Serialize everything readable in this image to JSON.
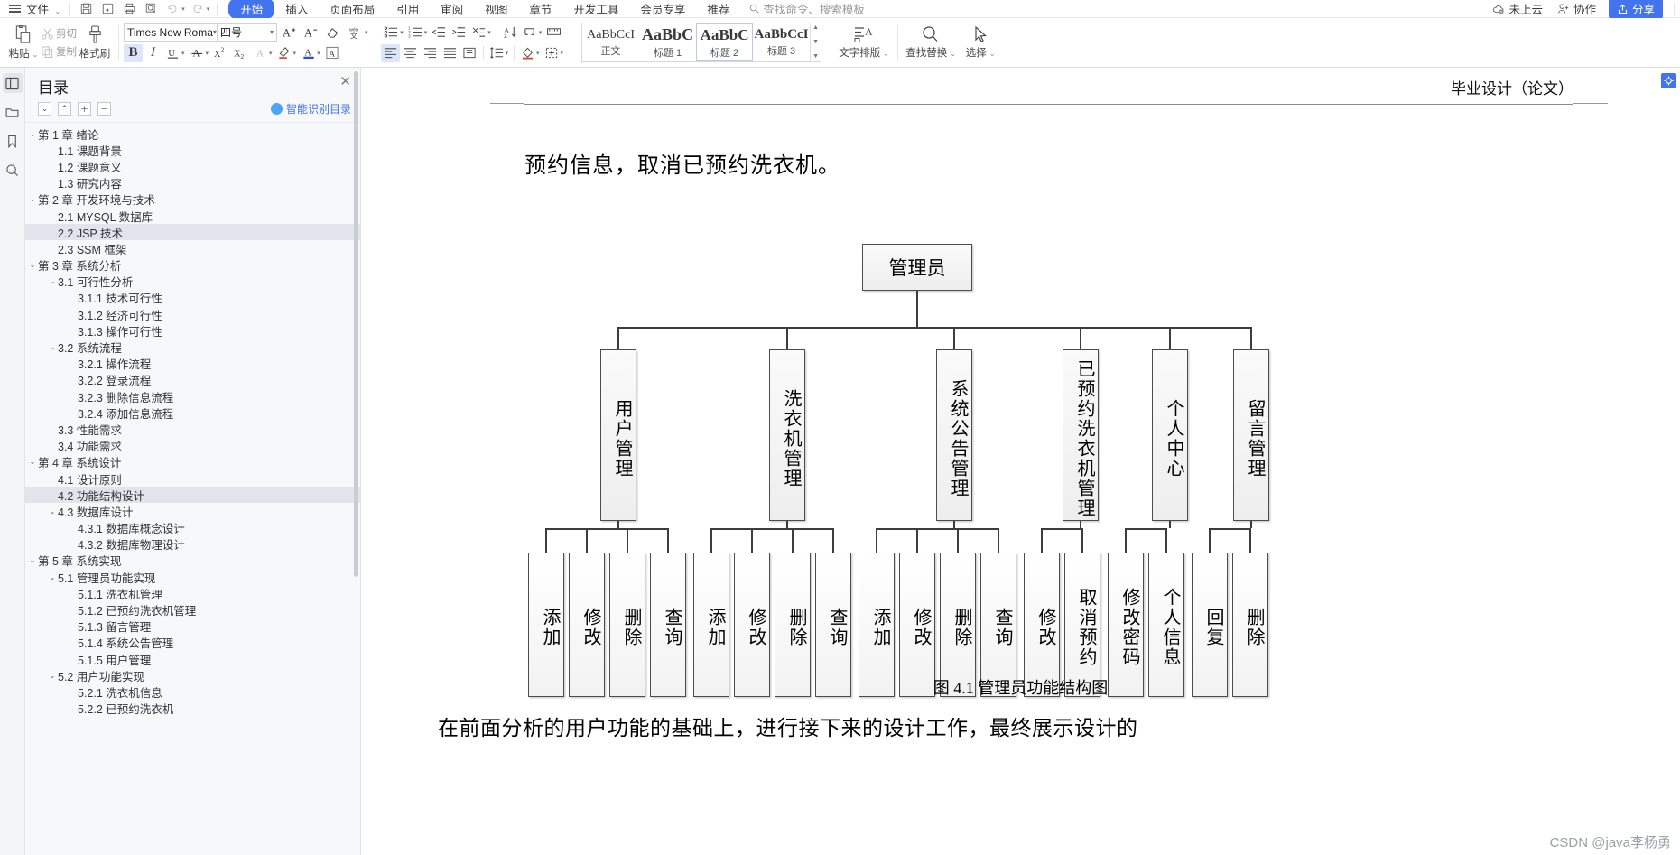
{
  "menubar": {
    "file_label": "文件",
    "quick_icons": [
      "save-icon",
      "save-as-icon",
      "print-icon",
      "print-preview-icon",
      "undo-icon",
      "redo-icon",
      "customize-caret-icon"
    ],
    "tabs": [
      {
        "label": "开始",
        "active": true
      },
      {
        "label": "插入",
        "active": false
      },
      {
        "label": "页面布局",
        "active": false
      },
      {
        "label": "引用",
        "active": false
      },
      {
        "label": "审阅",
        "active": false
      },
      {
        "label": "视图",
        "active": false
      },
      {
        "label": "章节",
        "active": false
      },
      {
        "label": "开发工具",
        "active": false
      },
      {
        "label": "会员专享",
        "active": false
      },
      {
        "label": "推荐",
        "active": false
      }
    ],
    "search_placeholder": "查找命令、搜索模板",
    "cloud_status": "未上云",
    "collaborate": "协作",
    "share": "分享",
    "accent_color": "#4274f0"
  },
  "ribbon": {
    "clipboard": {
      "paste": "粘贴",
      "cut": "剪切",
      "copy": "复制",
      "format_painter": "格式刷"
    },
    "font": {
      "family_value": "Times New Roma",
      "size_value": "四号",
      "grow_label": "A+",
      "shrink_label": "A-",
      "bold": "B",
      "italic": "I",
      "underline": "U",
      "strikethrough": "A",
      "superscript": "X²",
      "subscript": "X₂",
      "char_border": "A",
      "highlight": "A",
      "font_color": "A",
      "clear_format": "clear-format-icon",
      "pinyin": "拼音指南",
      "text_effect_box": "A"
    },
    "paragraph": {
      "bullets": "bullet-list-icon",
      "numbering": "numbered-list-icon",
      "decrease_indent": "decrease-indent-icon",
      "increase_indent": "increase-indent-icon",
      "ct_style": "chinese-layout-icon",
      "sort": "sort-icon",
      "show_marks": "show-marks-icon",
      "ruler": "ruler-icon",
      "align_left": "align-left-icon",
      "align_center": "align-center-icon",
      "align_right": "align-right-icon",
      "justify": "justify-icon",
      "distribute": "distribute-icon",
      "line_spacing": "line-spacing-icon",
      "shading": "shading-icon",
      "borders": "borders-icon"
    },
    "styles": [
      {
        "preview": "AaBbCcI",
        "name": "正文",
        "selected": false
      },
      {
        "preview": "AaBbC",
        "name": "标题 1",
        "selected": false
      },
      {
        "preview": "AaBbC",
        "name": "标题 2",
        "selected": true
      },
      {
        "preview": "AaBbCcI",
        "name": "标题 3",
        "selected": false
      }
    ],
    "tools": [
      {
        "label": "文字排版",
        "icon": "text-layout-icon"
      },
      {
        "label": "查找替换",
        "icon": "search-icon"
      },
      {
        "label": "选择",
        "icon": "cursor-select-icon"
      }
    ]
  },
  "rail": {
    "items": [
      {
        "name": "outline-panel-icon",
        "active": true
      },
      {
        "name": "folder-icon",
        "active": false
      },
      {
        "name": "bookmark-icon",
        "active": false
      },
      {
        "name": "search-icon",
        "active": false
      }
    ]
  },
  "toc": {
    "title": "目录",
    "close_label": "✕",
    "tools": [
      "⌄",
      "⌃",
      "＋",
      "－"
    ],
    "smart_label": "智能识别目录",
    "items": [
      {
        "text": "第 1 章 绪论",
        "level": 0,
        "chevron": "⌄",
        "selected": false
      },
      {
        "text": "1.1 课题背景",
        "level": 1,
        "chevron": "",
        "selected": false
      },
      {
        "text": "1.2 课题意义",
        "level": 1,
        "chevron": "",
        "selected": false
      },
      {
        "text": "1.3 研究内容",
        "level": 1,
        "chevron": "",
        "selected": false
      },
      {
        "text": "第 2 章 开发环境与技术",
        "level": 0,
        "chevron": "⌄",
        "selected": false
      },
      {
        "text": "2.1 MYSQL 数据库",
        "level": 1,
        "chevron": "",
        "selected": false
      },
      {
        "text": "2.2 JSP 技术",
        "level": 1,
        "chevron": "",
        "selected": true
      },
      {
        "text": "2.3 SSM 框架",
        "level": 1,
        "chevron": "",
        "selected": false
      },
      {
        "text": "第 3 章 系统分析",
        "level": 0,
        "chevron": "⌄",
        "selected": false
      },
      {
        "text": "3.1 可行性分析",
        "level": 1,
        "chevron": "⌄",
        "selected": false
      },
      {
        "text": "3.1.1 技术可行性",
        "level": 2,
        "chevron": "",
        "selected": false
      },
      {
        "text": "3.1.2 经济可行性",
        "level": 2,
        "chevron": "",
        "selected": false
      },
      {
        "text": "3.1.3 操作可行性",
        "level": 2,
        "chevron": "",
        "selected": false
      },
      {
        "text": "3.2 系统流程",
        "level": 1,
        "chevron": "⌄",
        "selected": false
      },
      {
        "text": "3.2.1 操作流程",
        "level": 2,
        "chevron": "",
        "selected": false
      },
      {
        "text": "3.2.2 登录流程",
        "level": 2,
        "chevron": "",
        "selected": false
      },
      {
        "text": "3.2.3 删除信息流程",
        "level": 2,
        "chevron": "",
        "selected": false
      },
      {
        "text": "3.2.4 添加信息流程",
        "level": 2,
        "chevron": "",
        "selected": false
      },
      {
        "text": "3.3 性能需求",
        "level": 1,
        "chevron": "",
        "selected": false
      },
      {
        "text": "3.4 功能需求",
        "level": 1,
        "chevron": "",
        "selected": false
      },
      {
        "text": "第 4 章 系统设计",
        "level": 0,
        "chevron": "⌄",
        "selected": false
      },
      {
        "text": "4.1 设计原则",
        "level": 1,
        "chevron": "",
        "selected": false
      },
      {
        "text": "4.2 功能结构设计",
        "level": 1,
        "chevron": "",
        "selected": true
      },
      {
        "text": "4.3 数据库设计",
        "level": 1,
        "chevron": "⌄",
        "selected": false
      },
      {
        "text": "4.3.1 数据库概念设计",
        "level": 2,
        "chevron": "",
        "selected": false
      },
      {
        "text": "4.3.2 数据库物理设计",
        "level": 2,
        "chevron": "",
        "selected": false
      },
      {
        "text": "第 5 章 系统实现",
        "level": 0,
        "chevron": "⌄",
        "selected": false
      },
      {
        "text": "5.1 管理员功能实现",
        "level": 1,
        "chevron": "⌄",
        "selected": false
      },
      {
        "text": "5.1.1 洗衣机管理",
        "level": 2,
        "chevron": "",
        "selected": false
      },
      {
        "text": "5.1.2 已预约洗衣机管理",
        "level": 2,
        "chevron": "",
        "selected": false
      },
      {
        "text": "5.1.3 留言管理",
        "level": 2,
        "chevron": "",
        "selected": false
      },
      {
        "text": "5.1.4 系统公告管理",
        "level": 2,
        "chevron": "",
        "selected": false
      },
      {
        "text": "5.1.5 用户管理",
        "level": 2,
        "chevron": "",
        "selected": false
      },
      {
        "text": "5.2 用户功能实现",
        "level": 1,
        "chevron": "⌄",
        "selected": false
      },
      {
        "text": "5.2.1 洗衣机信息",
        "level": 2,
        "chevron": "",
        "selected": false
      },
      {
        "text": "5.2.2 已预约洗衣机",
        "level": 2,
        "chevron": "",
        "selected": false
      }
    ]
  },
  "document": {
    "header_right": "毕业设计（论文）",
    "paragraph_top": "预约信息，取消已预约洗衣机。",
    "figure_caption": "图 4.1  管理员功能结构图",
    "paragraph_bottom": "在前面分析的用户功能的基础上，进行接下来的设计工作，最终展示设计的",
    "diagram": {
      "root": "管理员",
      "branches": [
        {
          "label": "用户管理",
          "children": [
            "添加",
            "修改",
            "删除",
            "查询"
          ]
        },
        {
          "label": "洗衣机管理",
          "children": [
            "添加",
            "修改",
            "删除",
            "查询"
          ]
        },
        {
          "label": "系统公告管理",
          "children": [
            "添加",
            "修改",
            "删除",
            "查询"
          ]
        },
        {
          "label": "已预约洗衣机管理",
          "children": [
            "修改",
            "取消预约"
          ]
        },
        {
          "label": "个人中心",
          "children": [
            "修改密码",
            "个人信息"
          ]
        },
        {
          "label": "留言管理",
          "children": [
            "回复",
            "删除"
          ]
        }
      ]
    }
  },
  "right_edge": {
    "locate_icon": "locate-icon"
  },
  "watermark": "CSDN @java李杨勇"
}
